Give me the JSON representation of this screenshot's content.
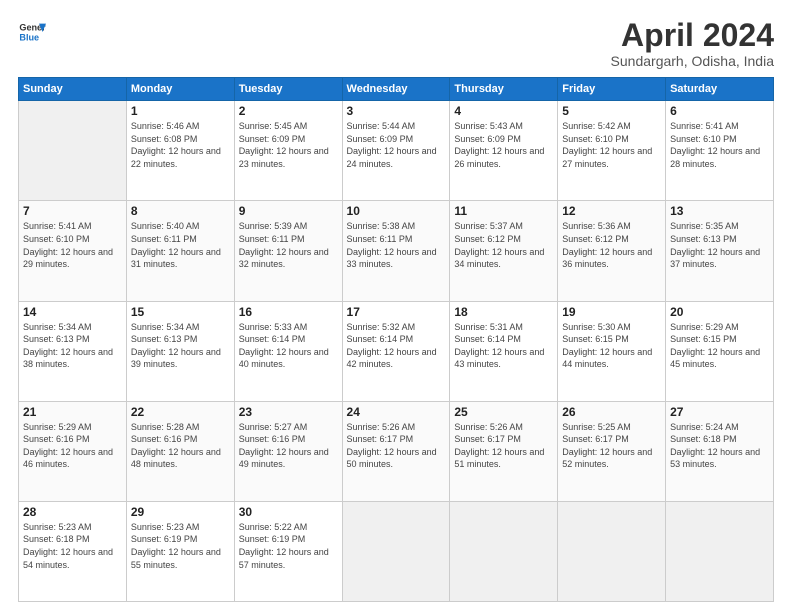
{
  "header": {
    "logo_line1": "General",
    "logo_line2": "Blue",
    "title": "April 2024",
    "subtitle": "Sundargarh, Odisha, India"
  },
  "weekdays": [
    "Sunday",
    "Monday",
    "Tuesday",
    "Wednesday",
    "Thursday",
    "Friday",
    "Saturday"
  ],
  "weeks": [
    [
      {
        "day": "",
        "empty": true
      },
      {
        "day": "1",
        "sunrise": "5:46 AM",
        "sunset": "6:08 PM",
        "daylight": "12 hours and 22 minutes."
      },
      {
        "day": "2",
        "sunrise": "5:45 AM",
        "sunset": "6:09 PM",
        "daylight": "12 hours and 23 minutes."
      },
      {
        "day": "3",
        "sunrise": "5:44 AM",
        "sunset": "6:09 PM",
        "daylight": "12 hours and 24 minutes."
      },
      {
        "day": "4",
        "sunrise": "5:43 AM",
        "sunset": "6:09 PM",
        "daylight": "12 hours and 26 minutes."
      },
      {
        "day": "5",
        "sunrise": "5:42 AM",
        "sunset": "6:10 PM",
        "daylight": "12 hours and 27 minutes."
      },
      {
        "day": "6",
        "sunrise": "5:41 AM",
        "sunset": "6:10 PM",
        "daylight": "12 hours and 28 minutes."
      }
    ],
    [
      {
        "day": "7",
        "sunrise": "5:41 AM",
        "sunset": "6:10 PM",
        "daylight": "12 hours and 29 minutes."
      },
      {
        "day": "8",
        "sunrise": "5:40 AM",
        "sunset": "6:11 PM",
        "daylight": "12 hours and 31 minutes."
      },
      {
        "day": "9",
        "sunrise": "5:39 AM",
        "sunset": "6:11 PM",
        "daylight": "12 hours and 32 minutes."
      },
      {
        "day": "10",
        "sunrise": "5:38 AM",
        "sunset": "6:11 PM",
        "daylight": "12 hours and 33 minutes."
      },
      {
        "day": "11",
        "sunrise": "5:37 AM",
        "sunset": "6:12 PM",
        "daylight": "12 hours and 34 minutes."
      },
      {
        "day": "12",
        "sunrise": "5:36 AM",
        "sunset": "6:12 PM",
        "daylight": "12 hours and 36 minutes."
      },
      {
        "day": "13",
        "sunrise": "5:35 AM",
        "sunset": "6:13 PM",
        "daylight": "12 hours and 37 minutes."
      }
    ],
    [
      {
        "day": "14",
        "sunrise": "5:34 AM",
        "sunset": "6:13 PM",
        "daylight": "12 hours and 38 minutes."
      },
      {
        "day": "15",
        "sunrise": "5:34 AM",
        "sunset": "6:13 PM",
        "daylight": "12 hours and 39 minutes."
      },
      {
        "day": "16",
        "sunrise": "5:33 AM",
        "sunset": "6:14 PM",
        "daylight": "12 hours and 40 minutes."
      },
      {
        "day": "17",
        "sunrise": "5:32 AM",
        "sunset": "6:14 PM",
        "daylight": "12 hours and 42 minutes."
      },
      {
        "day": "18",
        "sunrise": "5:31 AM",
        "sunset": "6:14 PM",
        "daylight": "12 hours and 43 minutes."
      },
      {
        "day": "19",
        "sunrise": "5:30 AM",
        "sunset": "6:15 PM",
        "daylight": "12 hours and 44 minutes."
      },
      {
        "day": "20",
        "sunrise": "5:29 AM",
        "sunset": "6:15 PM",
        "daylight": "12 hours and 45 minutes."
      }
    ],
    [
      {
        "day": "21",
        "sunrise": "5:29 AM",
        "sunset": "6:16 PM",
        "daylight": "12 hours and 46 minutes."
      },
      {
        "day": "22",
        "sunrise": "5:28 AM",
        "sunset": "6:16 PM",
        "daylight": "12 hours and 48 minutes."
      },
      {
        "day": "23",
        "sunrise": "5:27 AM",
        "sunset": "6:16 PM",
        "daylight": "12 hours and 49 minutes."
      },
      {
        "day": "24",
        "sunrise": "5:26 AM",
        "sunset": "6:17 PM",
        "daylight": "12 hours and 50 minutes."
      },
      {
        "day": "25",
        "sunrise": "5:26 AM",
        "sunset": "6:17 PM",
        "daylight": "12 hours and 51 minutes."
      },
      {
        "day": "26",
        "sunrise": "5:25 AM",
        "sunset": "6:17 PM",
        "daylight": "12 hours and 52 minutes."
      },
      {
        "day": "27",
        "sunrise": "5:24 AM",
        "sunset": "6:18 PM",
        "daylight": "12 hours and 53 minutes."
      }
    ],
    [
      {
        "day": "28",
        "sunrise": "5:23 AM",
        "sunset": "6:18 PM",
        "daylight": "12 hours and 54 minutes."
      },
      {
        "day": "29",
        "sunrise": "5:23 AM",
        "sunset": "6:19 PM",
        "daylight": "12 hours and 55 minutes."
      },
      {
        "day": "30",
        "sunrise": "5:22 AM",
        "sunset": "6:19 PM",
        "daylight": "12 hours and 57 minutes."
      },
      {
        "day": "",
        "empty": true
      },
      {
        "day": "",
        "empty": true
      },
      {
        "day": "",
        "empty": true
      },
      {
        "day": "",
        "empty": true
      }
    ]
  ]
}
